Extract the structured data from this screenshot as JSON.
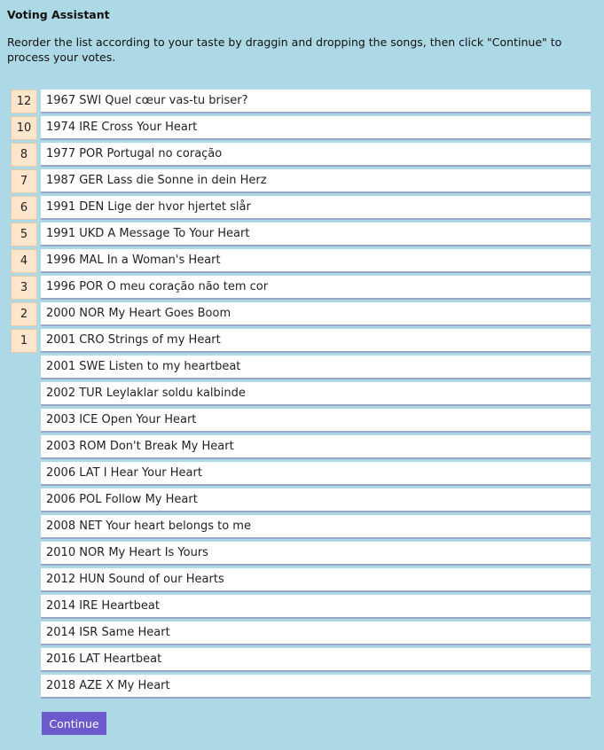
{
  "header": {
    "title": "Voting Assistant",
    "instructions": "Reorder the list according to your taste by draggin and dropping the songs, then click \"Continue\" to process your votes."
  },
  "points": [
    "12",
    "10",
    "8",
    "7",
    "6",
    "5",
    "4",
    "3",
    "2",
    "1"
  ],
  "songs": [
    "1967 SWI Quel cœur vas-tu briser?",
    "1974 IRE Cross Your Heart",
    "1977 POR Portugal no coração",
    "1987 GER Lass die Sonne in dein Herz",
    "1991 DEN Lige der hvor hjertet slår",
    "1991 UKD A Message To Your Heart",
    "1996 MAL In a Woman's Heart",
    "1996 POR O meu coração não tem cor",
    "2000 NOR My Heart Goes Boom",
    "2001 CRO Strings of my Heart",
    "2001 SWE Listen to my heartbeat",
    "2002 TUR Leylaklar soldu kalbinde",
    "2003 ICE Open Your Heart",
    "2003 ROM Don't Break My Heart",
    "2006 LAT I Hear Your Heart",
    "2006 POL Follow My Heart",
    "2008 NET Your heart belongs to me",
    "2010 NOR My Heart Is Yours",
    "2012 HUN Sound of our Hearts",
    "2014 IRE Heartbeat",
    "2014 ISR Same Heart",
    "2016 LAT Heartbeat",
    "2018 AZE X My Heart"
  ],
  "actions": {
    "continue_label": "Continue"
  },
  "colors": {
    "background": "#add8e6",
    "points_badge": "#fde6cc",
    "song_row": "#ffffff",
    "row_separator": "#98a6c8",
    "button": "#6a5acd"
  }
}
